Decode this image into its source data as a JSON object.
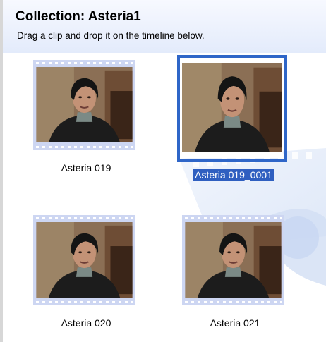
{
  "header": {
    "title": "Collection: Asteria1",
    "subtitle": "Drag a clip and drop it on the timeline below."
  },
  "clips": [
    {
      "label": "Asteria 019",
      "selected": false
    },
    {
      "label": "Asteria 019_0001",
      "selected": true
    },
    {
      "label": "Asteria 020",
      "selected": false
    },
    {
      "label": "Asteria 021",
      "selected": false
    }
  ],
  "colors": {
    "selection": "#2f66c8",
    "label_highlight": "#2f5fc0",
    "filmstrip": "#cdd6f2"
  }
}
